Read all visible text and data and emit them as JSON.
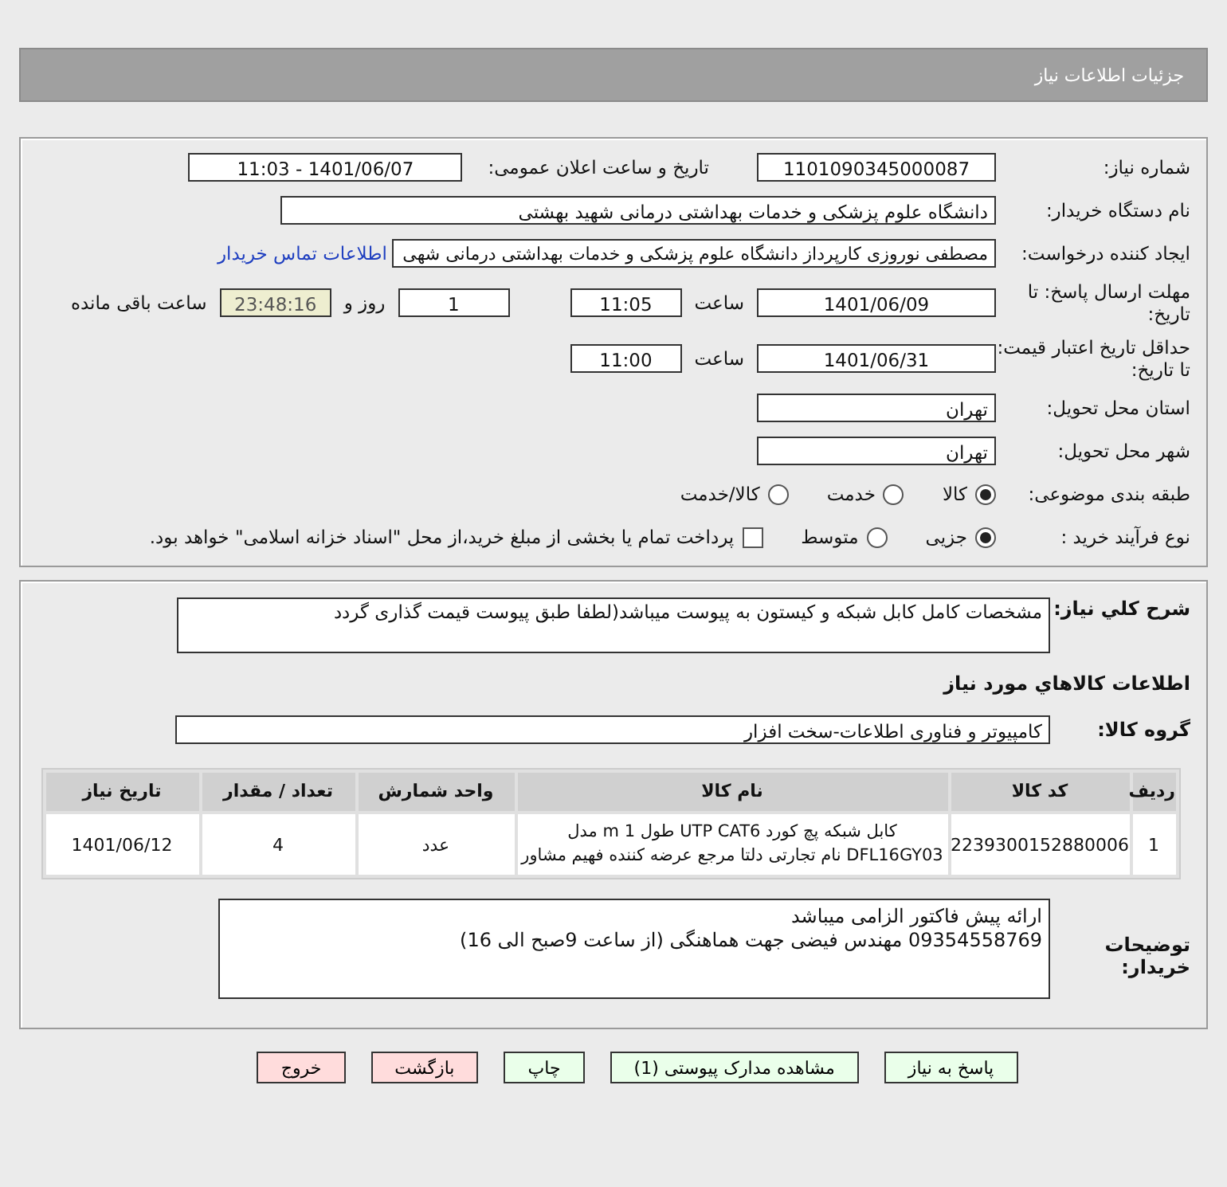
{
  "header": {
    "title": "جزئیات اطلاعات نیاز"
  },
  "need_number": {
    "label": "شماره نیاز:",
    "value": "1101090345000087"
  },
  "announce": {
    "label": "تاریخ و ساعت اعلان عمومی:",
    "value": "1401/06/07 - 11:03"
  },
  "buyer_org": {
    "label": "نام دستگاه خریدار:",
    "value": "دانشگاه علوم پزشکی و خدمات بهداشتی درمانی شهید بهشتی"
  },
  "requester": {
    "label": "ایجاد کننده درخواست:",
    "value": "مصطفی نوروزی کارپرداز دانشگاه علوم پزشکی و خدمات بهداشتی درمانی شهی",
    "link": "اطلاعات تماس خریدار"
  },
  "deadline": {
    "label": "مهلت ارسال پاسخ: تا تاریخ:",
    "date": "1401/06/09",
    "time_label": "ساعت",
    "time": "11:05",
    "days": "1",
    "days_label": "روز و",
    "remaining": "23:48:16",
    "remaining_label": "ساعت باقی مانده"
  },
  "validity": {
    "label": "حداقل تاریخ اعتبار قیمت: تا تاریخ:",
    "date": "1401/06/31",
    "time_label": "ساعت",
    "time": "11:00"
  },
  "province": {
    "label": "استان محل تحویل:",
    "value": "تهران"
  },
  "city": {
    "label": "شهر محل تحویل:",
    "value": "تهران"
  },
  "category": {
    "label": "طبقه بندی موضوعی:",
    "options": [
      {
        "label": "کالا",
        "selected": true
      },
      {
        "label": "خدمت",
        "selected": false
      },
      {
        "label": "کالا/خدمت",
        "selected": false
      }
    ]
  },
  "process": {
    "label": "نوع فرآیند خرید :",
    "options": [
      {
        "label": "جزیی",
        "selected": true
      },
      {
        "label": "متوسط",
        "selected": false
      }
    ],
    "payment": {
      "label": "پرداخت تمام یا بخشی از مبلغ خرید،از محل \"اسناد خزانه اسلامی\" خواهد بود.",
      "checked": false
    }
  },
  "description": {
    "label": "شرح کلي نياز:",
    "value": "مشخصات کامل کابل شبکه و کیستون به پیوست میباشد(لطفا طبق پیوست قیمت گذاری گردد"
  },
  "goods_heading": "اطلاعات کالاهاي مورد نياز",
  "goods_group": {
    "label": "گروه کالا:",
    "value": "کامپیوتر و فناوری اطلاعات-سخت افزار"
  },
  "table": {
    "columns": [
      "ردیف",
      "کد کالا",
      "نام کالا",
      "واحد شمارش",
      "تعداد / مقدار",
      "تاریخ نیاز"
    ],
    "rows": [
      [
        "1",
        "2239300152880006",
        "کابل شبکه پچ کورد UTP CAT6 طول 1 m مدل DFL16GY03 نام تجارتی دلتا مرجع عرضه کننده فهیم مشاور",
        "عدد",
        "4",
        "1401/06/12"
      ]
    ]
  },
  "buyer_notes": {
    "label": "توضیحات خریدار:",
    "lines": [
      "ارائه پیش فاکتور الزامی میباشد",
      "09354558769 مهندس فیضی جهت هماهنگی (از ساعت 9صبح الی 16)"
    ]
  },
  "buttons": [
    {
      "label": "پاسخ به نیاز",
      "kind": "primary"
    },
    {
      "label": "مشاهده مدارک پیوستی (1)",
      "kind": "primary"
    },
    {
      "label": "چاپ",
      "kind": "primary"
    },
    {
      "label": "بازگشت",
      "kind": "danger"
    },
    {
      "label": "خروج",
      "kind": "danger"
    }
  ]
}
